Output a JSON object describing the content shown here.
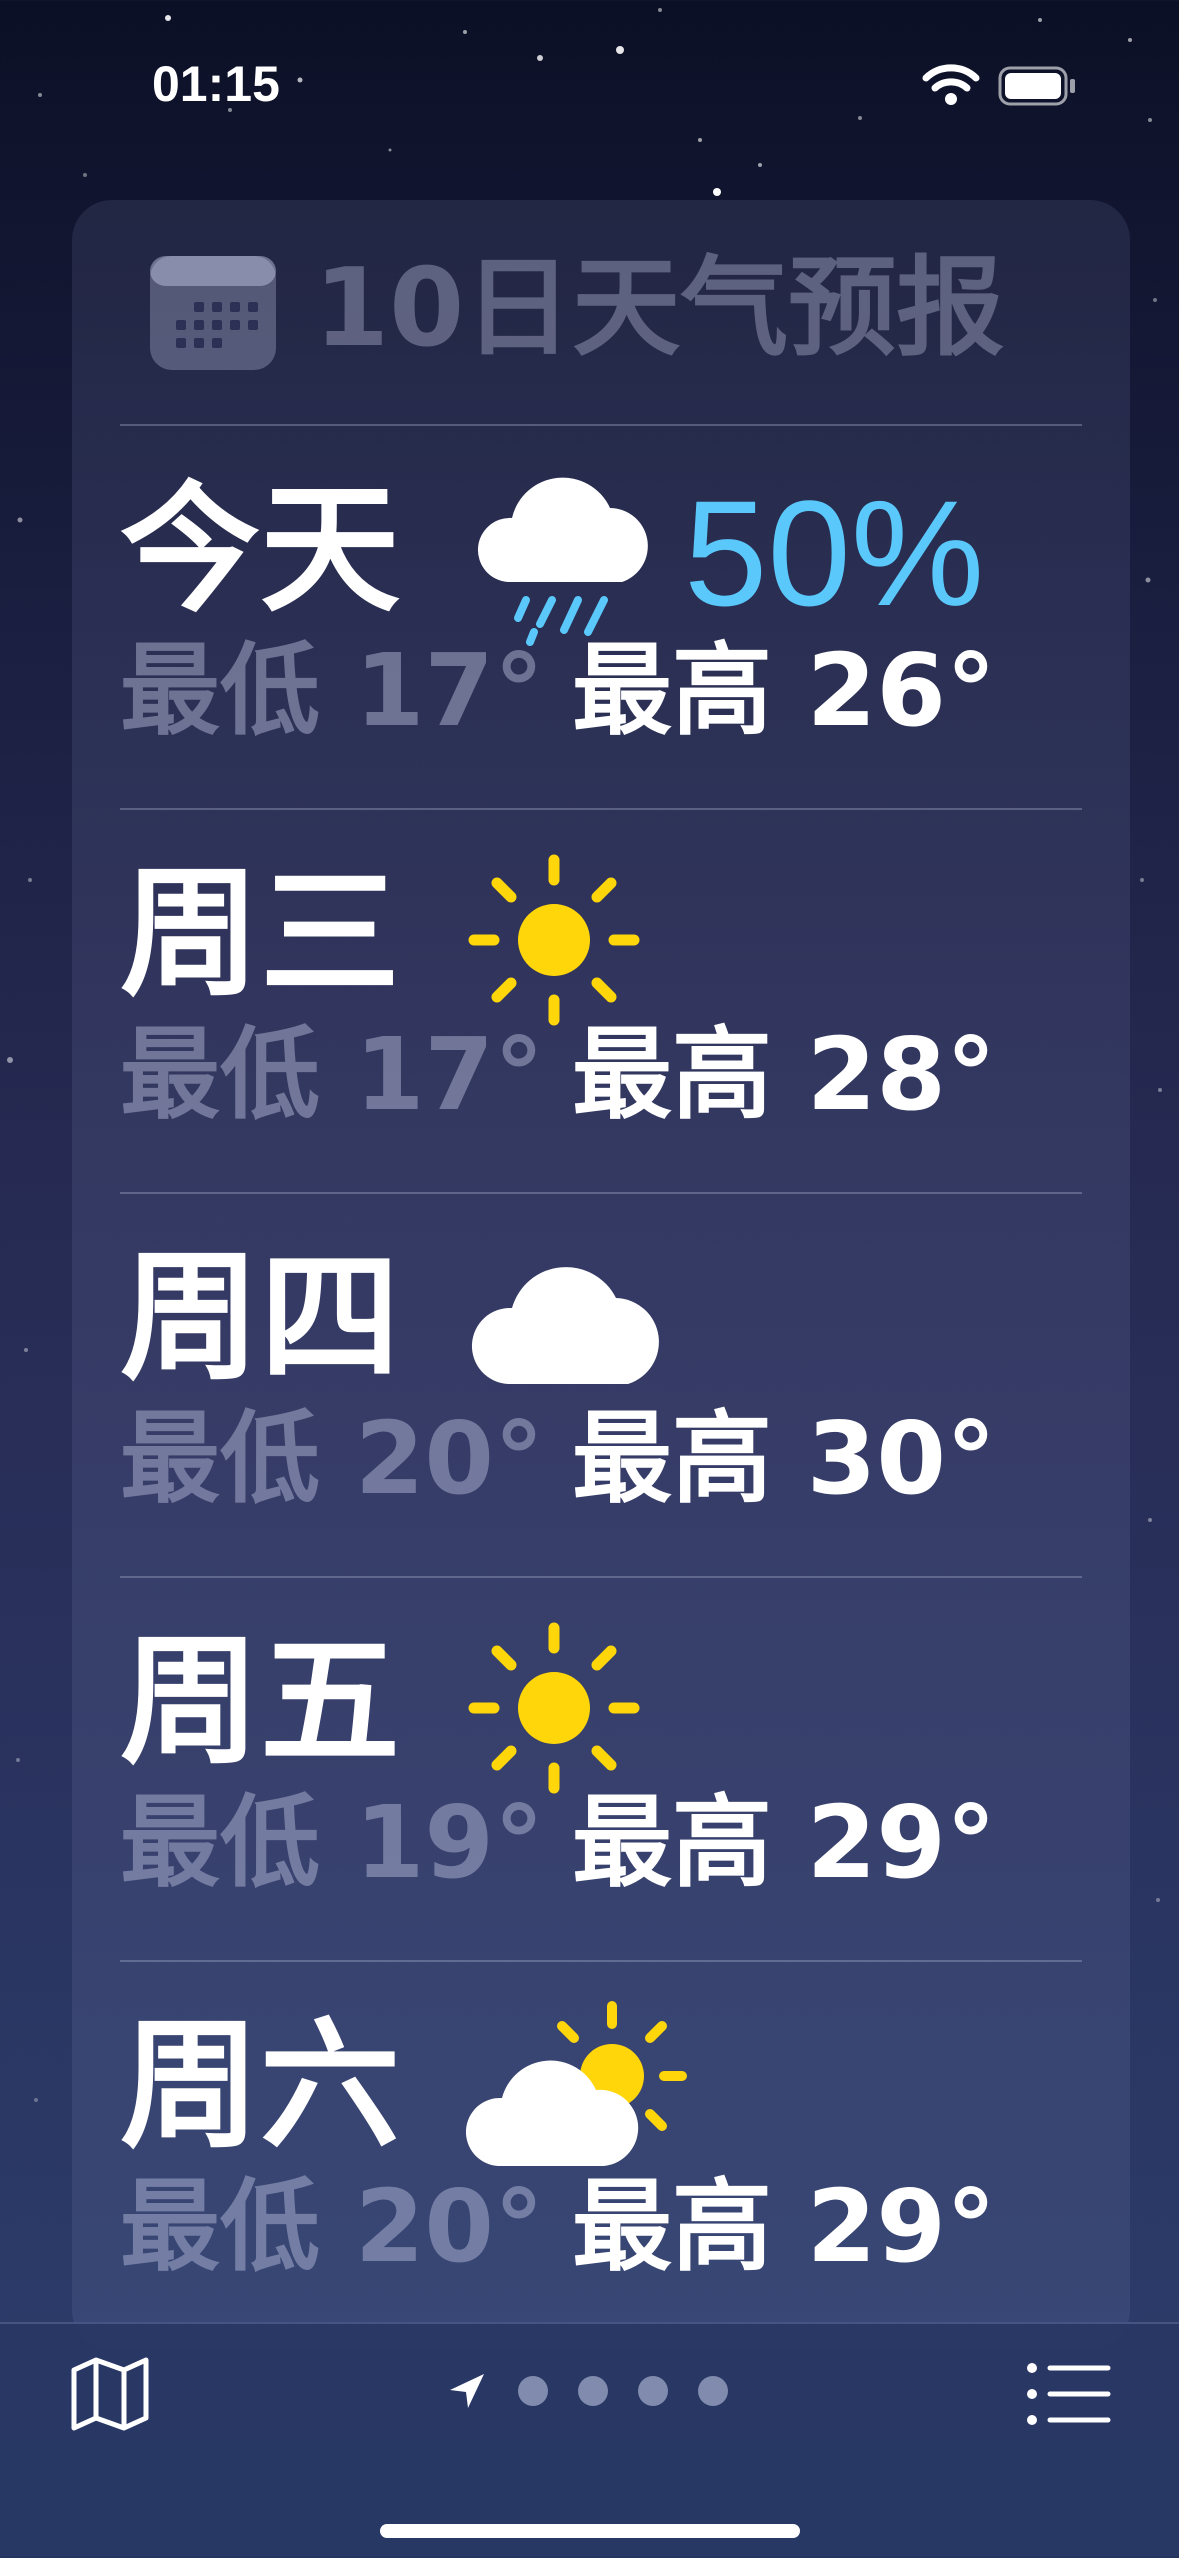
{
  "status_bar": {
    "time": "01:15"
  },
  "forecast": {
    "title": "10日天气预报",
    "days": [
      {
        "day": "今天",
        "icon": "cloud-rain-icon",
        "precip": "50%",
        "low": "最低 17°",
        "high": "最高 26°"
      },
      {
        "day": "周三",
        "icon": "sun-icon",
        "low": "最低 17°",
        "high": "最高 28°"
      },
      {
        "day": "周四",
        "icon": "cloud-icon",
        "low": "最低 20°",
        "high": "最高 30°"
      },
      {
        "day": "周五",
        "icon": "sun-icon",
        "low": "最低 19°",
        "high": "最高 29°"
      },
      {
        "day": "周六",
        "icon": "partly-cloudy-icon",
        "low": "最低 20°",
        "high": "最高 29°"
      }
    ]
  },
  "colors": {
    "precip": "#5ac8fa",
    "sun": "#ffd60a",
    "background_top": "#0c1026",
    "background_bottom": "#2c3e6c"
  },
  "toolbar": {
    "map_icon": "map-icon",
    "location_icon": "location-arrow-icon",
    "list_icon": "list-icon",
    "page_count": 5,
    "current_page": 1
  }
}
